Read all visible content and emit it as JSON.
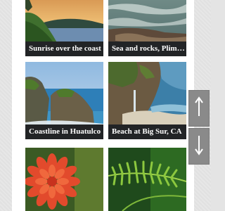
{
  "gallery": {
    "items": [
      {
        "caption": "Sunrise over the coast",
        "image": "sunrise-coast-photo"
      },
      {
        "caption": "Sea and rocks, Plimmerton",
        "image": "sea-rocks-photo"
      },
      {
        "caption": "Coastline in Huatulco",
        "image": "coastline-huatulco-photo"
      },
      {
        "caption": "Beach at Big Sur, CA",
        "image": "big-sur-beach-photo"
      },
      {
        "caption": "",
        "image": "red-dahlia-flower-photo"
      },
      {
        "caption": "",
        "image": "green-fern-photo"
      }
    ]
  },
  "controls": {
    "scroll_up_icon": "arrow-up-icon",
    "scroll_down_icon": "arrow-down-icon"
  },
  "colors": {
    "caption_bar": "#222426",
    "nav_button": "#8a8a8a"
  }
}
